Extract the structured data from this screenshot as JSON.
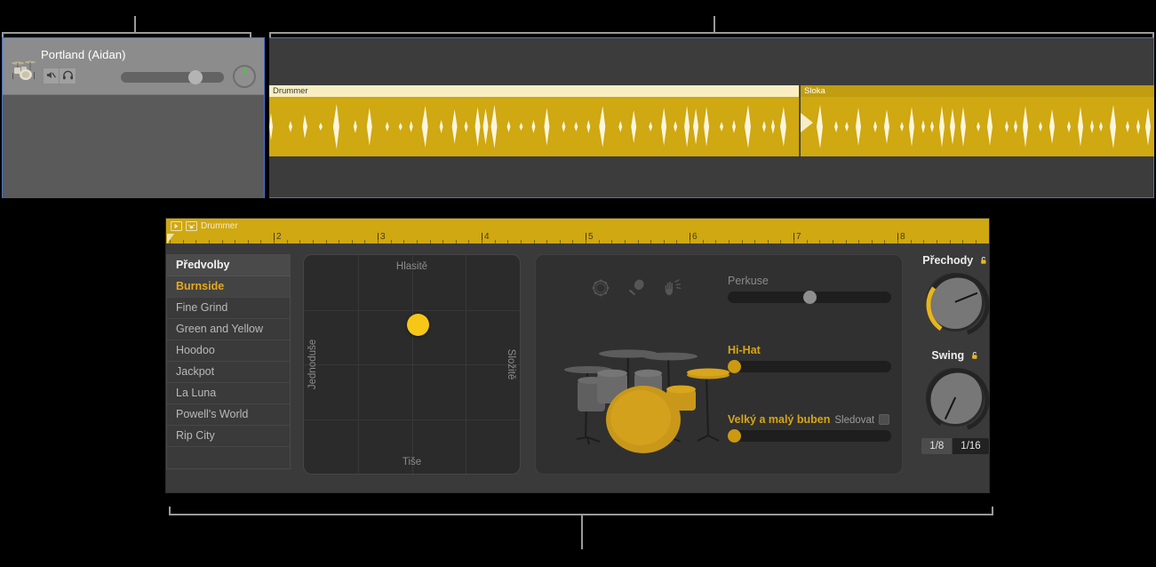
{
  "track": {
    "name": "Portland (Aidan)",
    "kit_icon": "drum-kit-icon",
    "mute_icon": "mute-speaker-icon",
    "solo_icon": "headphones-icon",
    "volume_percent": 66,
    "pan_value": 0
  },
  "regions": [
    {
      "label": "Drummer",
      "selected": false
    },
    {
      "label": "Sloka",
      "selected": true
    }
  ],
  "editor": {
    "ruler": {
      "title": "Drummer",
      "play_icon": "play-icon",
      "kit_icon": "drummer-icon",
      "bars": [
        "2",
        "3",
        "4",
        "5",
        "6",
        "7",
        "8"
      ]
    },
    "presets": {
      "header": "Předvolby",
      "items": [
        {
          "label": "Burnside",
          "selected": true
        },
        {
          "label": "Fine Grind",
          "selected": false
        },
        {
          "label": "Green and Yellow",
          "selected": false
        },
        {
          "label": "Hoodoo",
          "selected": false
        },
        {
          "label": "Jackpot",
          "selected": false
        },
        {
          "label": "La Luna",
          "selected": false
        },
        {
          "label": "Powell's World",
          "selected": false
        },
        {
          "label": "Rip City",
          "selected": false
        }
      ]
    },
    "xy_pad": {
      "top_label": "Hlasitě",
      "bottom_label": "Tiše",
      "left_label": "Jednoduše",
      "right_label": "Složitě",
      "puck_x_percent": 53,
      "puck_y_percent": 32,
      "puck_color": "#f6c717"
    },
    "kit_panel": {
      "percussion_icons": [
        "tambourine-icon",
        "shaker-icon",
        "clap-hand-icon"
      ],
      "sliders": [
        {
          "label": "Perkuse",
          "active": false,
          "value_percent": 50,
          "follow_label": null,
          "follow_checked": false
        },
        {
          "label": "Hi-Hat",
          "active": true,
          "value_percent": 2,
          "follow_label": null,
          "follow_checked": false
        },
        {
          "label": "Velký a malý buben",
          "active": true,
          "value_percent": 2,
          "follow_label": "Sledovat",
          "follow_checked": false
        }
      ]
    },
    "knobs": [
      {
        "label": "Přechody",
        "lock_icon": "unlocked-padlock-icon",
        "angle_deg": 68,
        "arc": true
      },
      {
        "label": "Swing",
        "lock_icon": "unlocked-padlock-icon",
        "angle_deg": 205,
        "arc": false
      }
    ],
    "swing_toggle": {
      "options": [
        {
          "label": "1/8",
          "selected": false
        },
        {
          "label": "1/16",
          "selected": true
        }
      ]
    }
  },
  "colors": {
    "accent_gold": "#cfa812",
    "highlight_yellow": "#e8a81c",
    "region_body": "#cfa812"
  }
}
